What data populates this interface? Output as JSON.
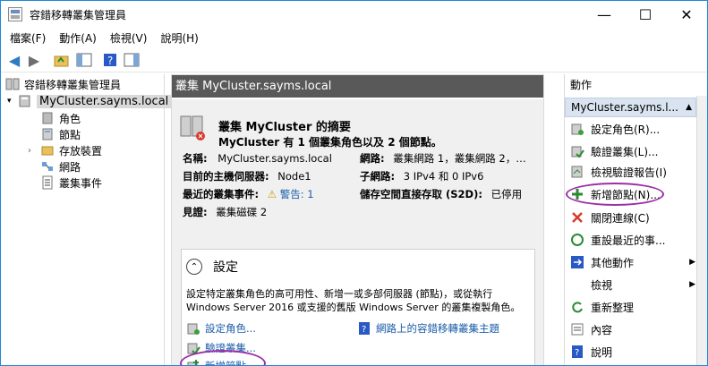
{
  "window": {
    "title": "容錯移轉叢集管理員",
    "minimize": "—",
    "maximize": "☐",
    "close": "✕"
  },
  "menu": [
    "檔案(F)",
    "動作(A)",
    "檢視(V)",
    "說明(H)"
  ],
  "tree": {
    "root": "容錯移轉叢集管理員",
    "cluster": "MyCluster.sayms.local",
    "children": [
      "角色",
      "節點",
      "存放裝置",
      "網路",
      "叢集事件"
    ]
  },
  "center": {
    "header": "叢集 MyCluster.sayms.local",
    "title": "叢集 MyCluster 的摘要",
    "subtitle": "MyCluster 有 1 個叢集角色以及 2 個節點。",
    "fields": {
      "name_label": "名稱:",
      "name_value": "MyCluster.sayms.local",
      "host_label": "目前的主機伺服器:",
      "host_value": "Node1",
      "events_label": "最近的叢集事件:",
      "events_value": "警告: 1",
      "witness_label": "見證:",
      "witness_value": "叢集磁碟 2",
      "network_label": "網路:",
      "network_value": "叢集網路 1，叢集網路 2，…",
      "subnet_label": "子網路:",
      "subnet_value": "3 IPv4 和 0 IPv6",
      "s2d_label": "儲存空間直接存取 (S2D):",
      "s2d_value": "已停用"
    },
    "settings": {
      "title": "設定",
      "desc": "設定特定叢集角色的高可用性、新增一或多部伺服器 (節點)，或從執行 Windows Server 2016 或支援的舊版 Windows Server 的叢集複製角色。",
      "links": [
        "設定角色...",
        "驗證叢集...",
        "新增節點...",
        "網路上的容錯移轉叢集主題"
      ]
    }
  },
  "actions": {
    "header": "動作",
    "subheader": "MyCluster.sayms.l...",
    "items": [
      "設定角色(R)...",
      "驗證叢集(L)...",
      "檢視驗證報告(I)",
      "新增節點(N)...",
      "關閉連線(C)",
      "重設最近的事...",
      "其他動作",
      "檢視",
      "重新整理",
      "內容",
      "說明"
    ]
  },
  "colors": {
    "header_bg": "#595959",
    "link": "#1a5ca8",
    "highlight_circle": "#9b30a7"
  }
}
